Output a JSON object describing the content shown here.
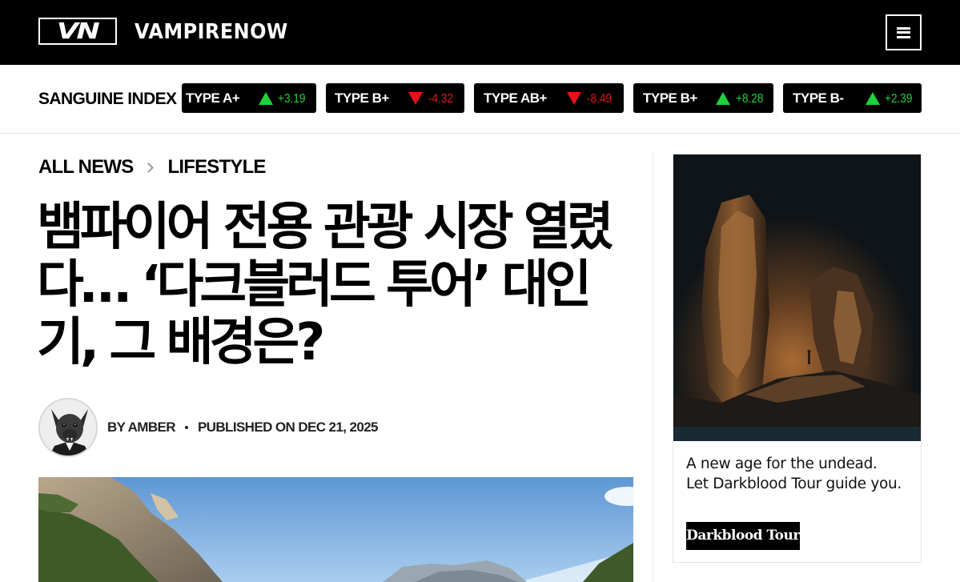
{
  "header": {
    "logo_text": "VN",
    "brand_name": "VAMPIRENOW",
    "menu_icon": "hamburger-menu-icon"
  },
  "ticker": {
    "label": "SANGUINE INDEX",
    "items": [
      {
        "type": "TYPE A+",
        "direction": "up",
        "delta": "+3.19"
      },
      {
        "type": "TYPE B+",
        "direction": "down",
        "delta": "-4.32"
      },
      {
        "type": "TYPE AB+",
        "direction": "down",
        "delta": "-8.49"
      },
      {
        "type": "TYPE B+",
        "direction": "up",
        "delta": "+8.28"
      },
      {
        "type": "TYPE B-",
        "direction": "up",
        "delta": "+2.39"
      }
    ],
    "colors": {
      "up": "#1fd13a",
      "down": "#e8111b"
    }
  },
  "breadcrumb": {
    "items": [
      "ALL NEWS",
      "LIFESTYLE"
    ],
    "separator_icon": "chevron-right-icon"
  },
  "article": {
    "headline": "뱀파이어 전용 관광 시장 열렸다… ‘다크블러드 투어’ 대인기, 그 배경은?",
    "author": "BY AMBER",
    "published": "PUBLISHED ON DEC 21, 2025",
    "hero_image": "mountain lake landscape"
  },
  "ad": {
    "image": "dark cave interior",
    "copy_line1": "A new age for the undead.",
    "copy_line2": "Let Darkblood Tour guide you.",
    "brand_button": "Darkblood Tour"
  }
}
